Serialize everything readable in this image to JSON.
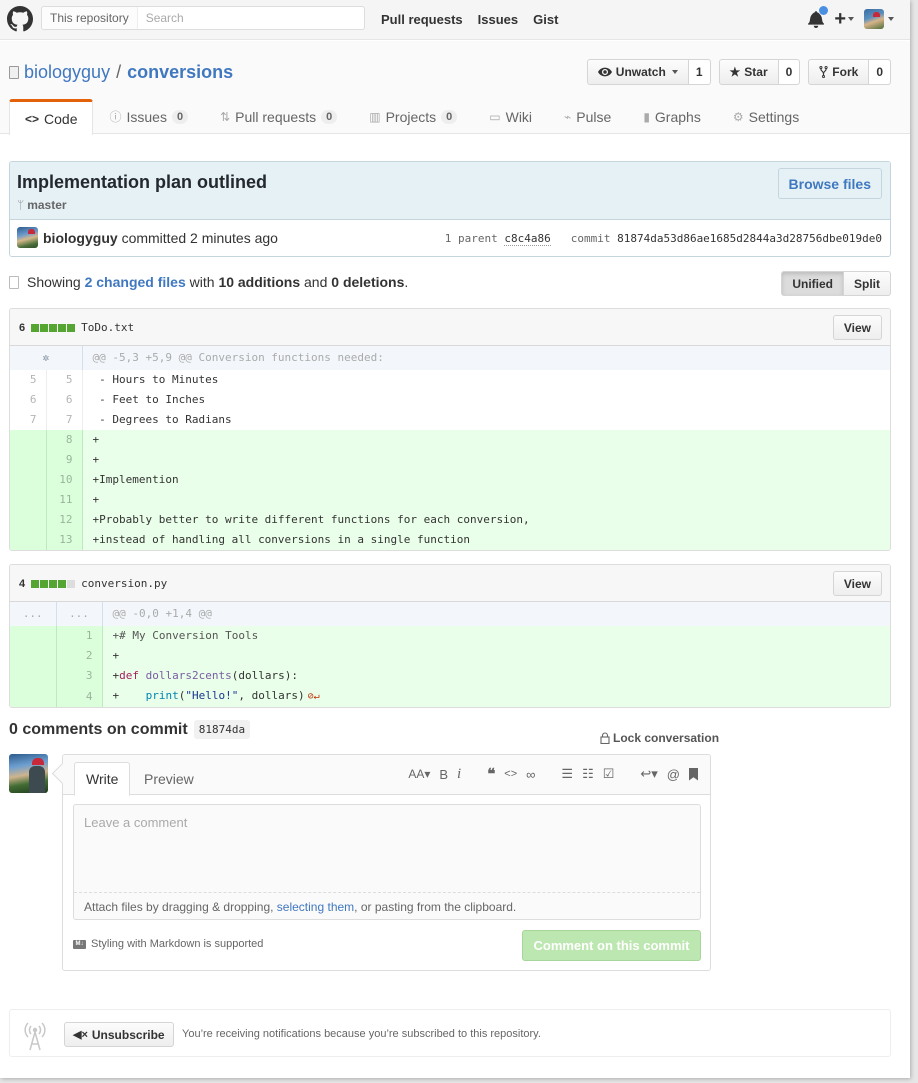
{
  "header": {
    "search_scope": "This repository",
    "search_placeholder": "Search",
    "nav": [
      "Pull requests",
      "Issues",
      "Gist"
    ],
    "icons": [
      "github-logo-icon",
      "bell-icon",
      "plus-icon",
      "avatar"
    ]
  },
  "repo": {
    "owner": "biologyguy",
    "separator": "/",
    "name": "conversions",
    "actions": {
      "watch_label": "Unwatch",
      "watch_count": "1",
      "star_label": "Star",
      "star_count": "0",
      "fork_label": "Fork",
      "fork_count": "0"
    },
    "tabs": [
      {
        "label": "Code",
        "counter": null,
        "active": true
      },
      {
        "label": "Issues",
        "counter": "0"
      },
      {
        "label": "Pull requests",
        "counter": "0"
      },
      {
        "label": "Projects",
        "counter": "0"
      },
      {
        "label": "Wiki",
        "counter": null
      },
      {
        "label": "Pulse",
        "counter": null
      },
      {
        "label": "Graphs",
        "counter": null
      },
      {
        "label": "Settings",
        "counter": null
      }
    ],
    "active_tab_color": "#e36209"
  },
  "commit": {
    "title": "Implementation plan outlined",
    "branch": "master",
    "browse_label": "Browse files",
    "author": "biologyguy",
    "action_text": "committed 2 minutes ago",
    "parent_label": "1 parent",
    "parent_sha": "c8c4a86",
    "commit_label": "commit",
    "sha": "81874da53d86ae1685d2844a3d28756dbe019de0"
  },
  "toc": {
    "showing": "Showing",
    "changed_files": "2 changed files",
    "with": "with",
    "additions": "10 additions",
    "and": "and",
    "deletions": "0 deletions",
    "period": ".",
    "unified_label": "Unified",
    "split_label": "Split"
  },
  "files": [
    {
      "changes": "6",
      "name": "ToDo.txt",
      "view_label": "View",
      "hunk": "@@ -5,3 +5,9 @@ Conversion functions needed:",
      "lines": [
        {
          "old": "5",
          "new": "5",
          "type": "ctx",
          "text": " - Hours to Minutes"
        },
        {
          "old": "6",
          "new": "6",
          "type": "ctx",
          "text": " - Feet to Inches"
        },
        {
          "old": "7",
          "new": "7",
          "type": "ctx",
          "text": " - Degrees to Radians"
        },
        {
          "old": "",
          "new": "8",
          "type": "add",
          "text": "+"
        },
        {
          "old": "",
          "new": "9",
          "type": "add",
          "text": "+"
        },
        {
          "old": "",
          "new": "10",
          "type": "add",
          "text": "+Implemention"
        },
        {
          "old": "",
          "new": "11",
          "type": "add",
          "text": "+"
        },
        {
          "old": "",
          "new": "12",
          "type": "add",
          "text": "+Probably better to write different functions for each conversion,"
        },
        {
          "old": "",
          "new": "13",
          "type": "add",
          "text": "+instead of handling all conversions in a single function"
        }
      ]
    },
    {
      "changes": "4",
      "name": "conversion.py",
      "view_label": "View",
      "hunk": "@@ -0,0 +1,4 @@",
      "hunk_old": "...",
      "hunk_new": "...",
      "lines": [
        {
          "old": "",
          "new": "1",
          "type": "add",
          "text": "+# My Conversion Tools"
        },
        {
          "old": "",
          "new": "2",
          "type": "add",
          "text": "+"
        },
        {
          "old": "",
          "new": "3",
          "type": "add",
          "prefix": "+",
          "kw": "def",
          "fn": " dollars2cents",
          "rest": "(dollars):"
        },
        {
          "old": "",
          "new": "4",
          "type": "add",
          "prefix": "+    ",
          "bi": "print",
          "open": "(",
          "str": "\"Hello!\"",
          "rest": ", dollars)",
          "noeol": "⊘↵"
        }
      ]
    }
  ],
  "comments": {
    "title": "0 comments on commit",
    "sha_short": "81874da",
    "lock_label": "Lock conversation",
    "write_tab": "Write",
    "preview_tab": "Preview",
    "toolbar": [
      "AA▾",
      "B",
      "i",
      "❝",
      "<>",
      "🔗",
      "☰",
      "1☰",
      "✓☰",
      "↩▾",
      "@",
      "🔖"
    ],
    "placeholder": "Leave a comment",
    "attach_prefix": "Attach files by dragging & dropping, ",
    "attach_link": "selecting them",
    "attach_suffix": ", or pasting from the clipboard.",
    "markdown_note": "Styling with Markdown is supported",
    "submit_label": "Comment on this commit",
    "submit_color": "#bde7b0"
  },
  "subscription": {
    "button_label": "Unsubscribe",
    "reason": "You’re receiving notifications because you’re subscribed to this repository."
  }
}
